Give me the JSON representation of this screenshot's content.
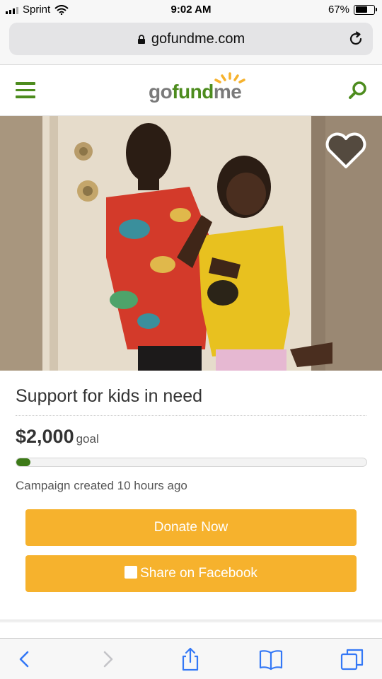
{
  "status": {
    "carrier": "Sprint",
    "time": "9:02 AM",
    "battery": "67%",
    "battery_level": 0.67
  },
  "browser": {
    "url": "gofundme.com"
  },
  "site": {
    "logo_go": "go",
    "logo_fund": "fund",
    "logo_me": "me"
  },
  "campaign": {
    "title": "Support for kids in need",
    "goal_amount": "$2,000",
    "goal_label": "goal",
    "progress_fraction": 0.04,
    "created": "Campaign created 10 hours ago",
    "donate_label": "Donate Now",
    "share_label": "Share on Facebook"
  },
  "colors": {
    "brand_green": "#4d8c1e",
    "button_orange": "#f6b22d",
    "ios_blue": "#3478f6"
  }
}
